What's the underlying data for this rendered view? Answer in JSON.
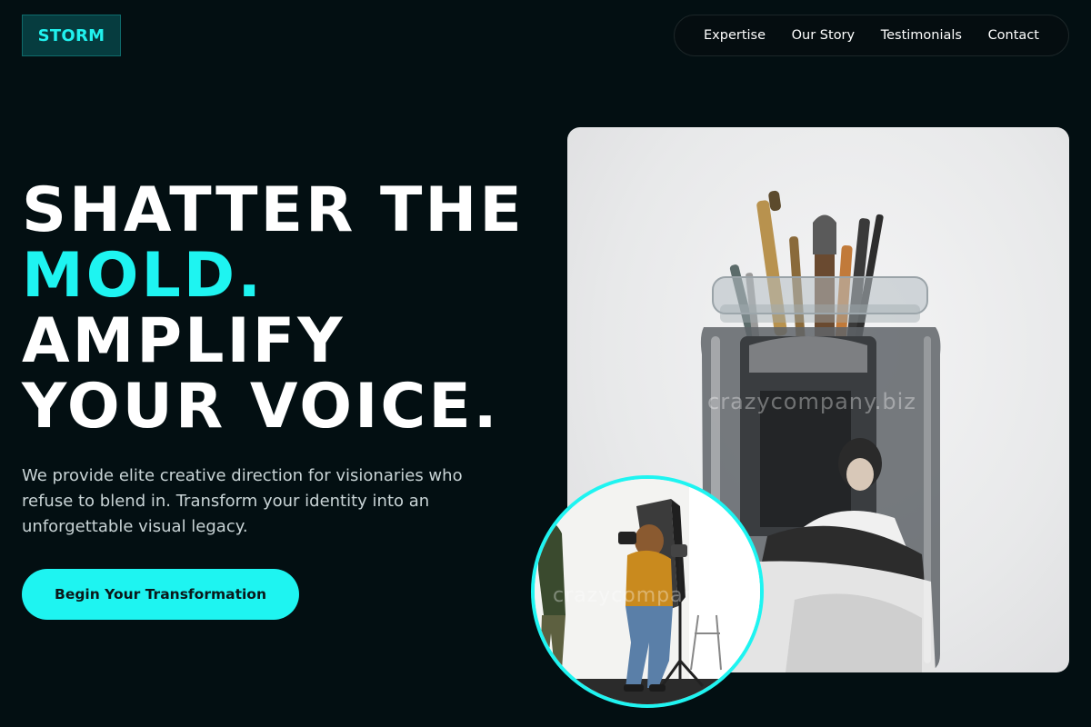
{
  "brand": {
    "logo_text": "STORM"
  },
  "nav": {
    "items": [
      {
        "label": "Expertise"
      },
      {
        "label": "Our Story"
      },
      {
        "label": "Testimonials"
      },
      {
        "label": "Contact"
      }
    ]
  },
  "hero": {
    "headline_line1": "SHATTER THE",
    "headline_line2": "MOLD.",
    "headline_line3": "AMPLIFY",
    "headline_line4": "YOUR VOICE.",
    "subtext": "We provide elite creative direction for visionaries who refuse to blend in. Transform your identity into an unforgettable visual legacy.",
    "cta_label": "Begin Your Transformation"
  },
  "images": {
    "main_watermark": "crazycompany.biz",
    "circle_watermark": "crazycompany.biz"
  },
  "colors": {
    "background": "#030f12",
    "accent": "#1ef4f1",
    "logo_bg": "#063c3f",
    "text_muted": "#c9d4d6"
  }
}
